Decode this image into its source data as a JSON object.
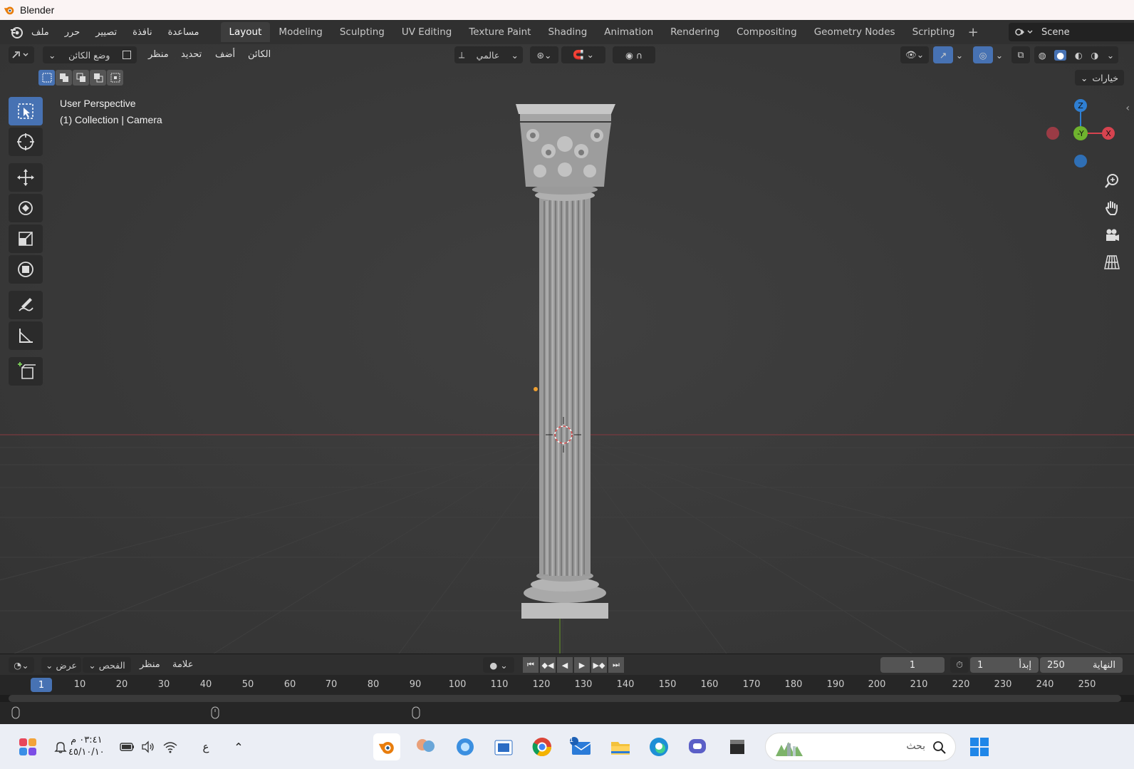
{
  "window": {
    "title": "Blender"
  },
  "menus": [
    "ملف",
    "حرر",
    "تصيير",
    "نافذة",
    "مساعدة"
  ],
  "workspaces": [
    "Layout",
    "Modeling",
    "Sculpting",
    "UV Editing",
    "Texture Paint",
    "Shading",
    "Animation",
    "Rendering",
    "Compositing",
    "Geometry Nodes",
    "Scripting"
  ],
  "active_workspace": "Layout",
  "scene": {
    "name": "Scene"
  },
  "viewport_header": {
    "mode": "وضع الكائن",
    "view": "منظر",
    "select": "تحديد",
    "add": "أضف",
    "object": "الكائن",
    "transform_orientation": "عالمي",
    "options": "خيارات"
  },
  "overlay": {
    "line1": "User Perspective",
    "line2": "(1) Collection | Camera"
  },
  "gizmo": {
    "z": "Z",
    "y": "-Y",
    "x": "X"
  },
  "timeline": {
    "view": "عرض",
    "inspect": "الفحص",
    "marker_view": "منظر",
    "marker": "علامة",
    "current_frame": "1",
    "start_label": "إبدأ",
    "start_value": "1",
    "end_label": "النهاية",
    "end_value": "250",
    "ruler_ticks": [
      "10",
      "20",
      "30",
      "40",
      "50",
      "60",
      "70",
      "80",
      "90",
      "100",
      "110",
      "120",
      "130",
      "140",
      "150",
      "160",
      "170",
      "180",
      "190",
      "200",
      "210",
      "220",
      "230",
      "240",
      "250"
    ],
    "ruler_current": "1"
  },
  "taskbar": {
    "time": "٠٣:٤١ م",
    "date": "٤٥/١٠/١٠",
    "lang": "ع",
    "search_placeholder": "بحث",
    "mail_badge": "1"
  },
  "colors": {
    "accent": "#4772b3",
    "axis_x": "#d6434f",
    "axis_y": "#6fb32e",
    "axis_z": "#2f7fd2"
  }
}
